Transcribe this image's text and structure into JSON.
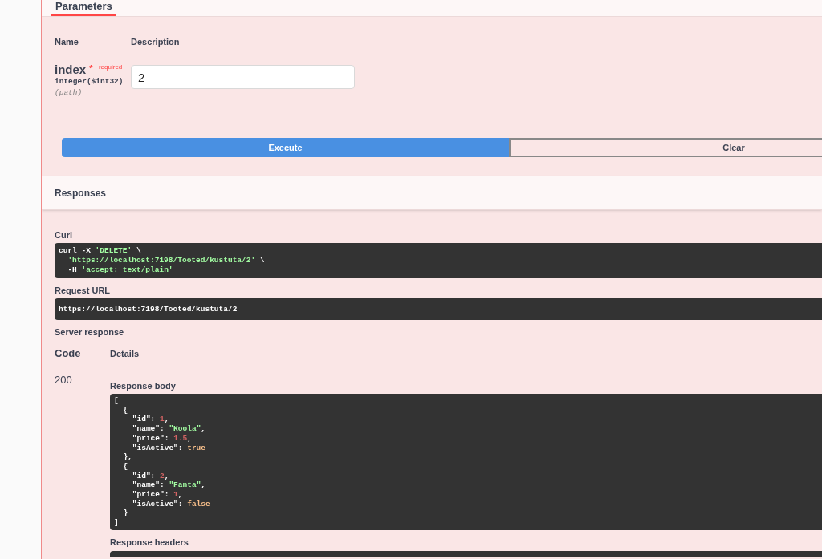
{
  "tabs": [
    {
      "label": "Parameters",
      "selected": true
    }
  ],
  "parameters": {
    "columns": [
      "Name",
      "Description"
    ],
    "items": [
      {
        "name": "index",
        "required_mark": "*",
        "required_label": "required",
        "type": "integer($int32)",
        "location": "(path)",
        "value": "2"
      }
    ]
  },
  "actions": [
    {
      "label": "Execute",
      "kind": "execute"
    },
    {
      "label": "Clear",
      "kind": "clear"
    }
  ],
  "responses": {
    "title": "Responses",
    "curl": {
      "label": "Curl",
      "lines": [
        [
          {
            "kind": "plain",
            "text": "curl -X "
          },
          {
            "kind": "string",
            "text": "'DELETE'"
          },
          {
            "kind": "plain",
            "text": " \\"
          }
        ],
        [
          {
            "kind": "string",
            "text": "  'https://localhost:7198/Tooted/kustuta/2'"
          },
          {
            "kind": "plain",
            "text": " \\"
          }
        ],
        [
          {
            "kind": "plain",
            "text": "  -H "
          },
          {
            "kind": "string",
            "text": "'accept: text/plain'"
          }
        ]
      ]
    },
    "request_url": {
      "label": "Request URL",
      "value": "https://localhost:7198/Tooted/kustuta/2"
    },
    "server_response": {
      "title": "Server response",
      "columns": [
        "Code",
        "Details"
      ],
      "rows": [
        {
          "code": "200",
          "body_label": "Response body",
          "body_lines": [
            [
              {
                "kind": "plain",
                "text": "["
              }
            ],
            [
              {
                "kind": "plain",
                "text": "  {"
              }
            ],
            [
              {
                "kind": "plain",
                "text": "    \"id\": "
              },
              {
                "kind": "number",
                "text": "1"
              },
              {
                "kind": "plain",
                "text": ","
              }
            ],
            [
              {
                "kind": "plain",
                "text": "    \"name\": "
              },
              {
                "kind": "string",
                "text": "\"Koola\""
              },
              {
                "kind": "plain",
                "text": ","
              }
            ],
            [
              {
                "kind": "plain",
                "text": "    \"price\": "
              },
              {
                "kind": "number",
                "text": "1.5"
              },
              {
                "kind": "plain",
                "text": ","
              }
            ],
            [
              {
                "kind": "plain",
                "text": "    \"isActive\": "
              },
              {
                "kind": "literal",
                "text": "true"
              }
            ],
            [
              {
                "kind": "plain",
                "text": "  },"
              }
            ],
            [
              {
                "kind": "plain",
                "text": "  {"
              }
            ],
            [
              {
                "kind": "plain",
                "text": "    \"id\": "
              },
              {
                "kind": "number",
                "text": "2"
              },
              {
                "kind": "plain",
                "text": ","
              }
            ],
            [
              {
                "kind": "plain",
                "text": "    \"name\": "
              },
              {
                "kind": "string",
                "text": "\"Fanta\""
              },
              {
                "kind": "plain",
                "text": ","
              }
            ],
            [
              {
                "kind": "plain",
                "text": "    \"price\": "
              },
              {
                "kind": "number",
                "text": "1"
              },
              {
                "kind": "plain",
                "text": ","
              }
            ],
            [
              {
                "kind": "plain",
                "text": "    \"isActive\": "
              },
              {
                "kind": "literal",
                "text": "false"
              }
            ],
            [
              {
                "kind": "plain",
                "text": "  }"
              }
            ],
            [
              {
                "kind": "plain",
                "text": "]"
              }
            ]
          ],
          "headers_label": "Response headers"
        }
      ]
    }
  }
}
